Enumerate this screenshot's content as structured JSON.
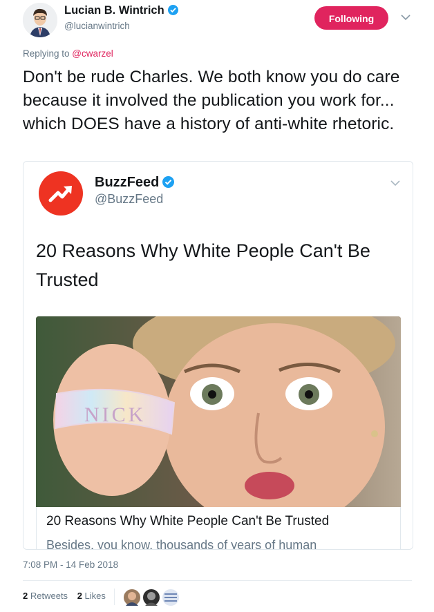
{
  "author": {
    "name": "Lucian B. Wintrich",
    "handle": "@lucianwintrich",
    "follow_label": "Following"
  },
  "reply": {
    "prefix": "Replying to ",
    "target": "@cwarzel"
  },
  "tweet": {
    "text": "Don't be rude Charles. We both know you do care because it involved the publication you work for... which DOES have a history of anti-white rhetoric."
  },
  "quoted": {
    "name": "BuzzFeed",
    "handle": "@BuzzFeed",
    "text": "20 Reasons Why White People Can't Be Trusted",
    "photo_bracelet_text": "NICK",
    "link_title": "20 Reasons Why White People Can't Be Trusted",
    "link_description": "Besides, you know, thousands of years of human"
  },
  "footer": {
    "timestamp": "7:08 PM - 14 Feb 2018",
    "retweets_count": "2",
    "retweets_label": "Retweets",
    "likes_count": "2",
    "likes_label": "Likes"
  },
  "colors": {
    "follow_button": "#e0245e",
    "verified": "#1da1f2",
    "buzzfeed_red": "#ee3322",
    "secondary_text": "#657786"
  }
}
